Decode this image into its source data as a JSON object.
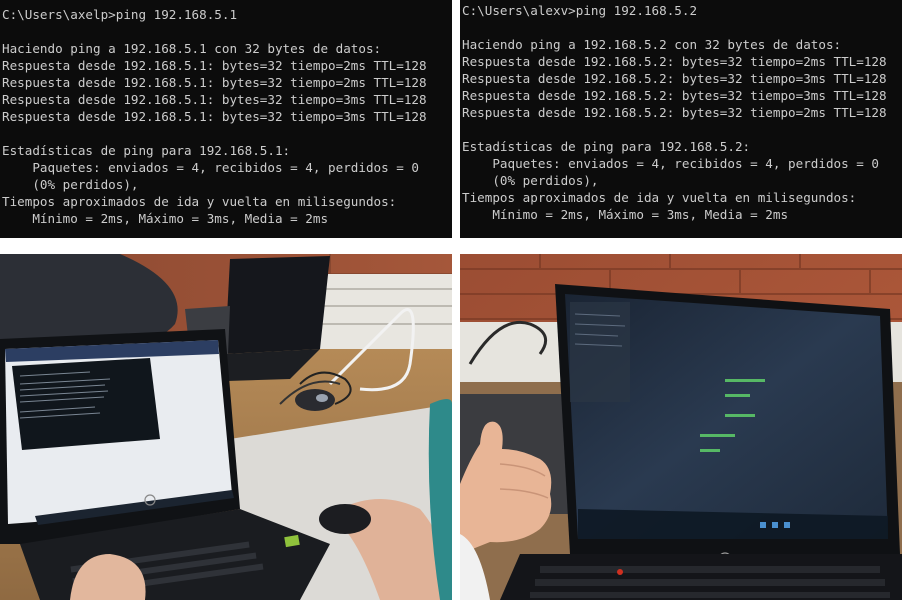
{
  "terminal_left": {
    "lines": [
      "C:\\Users\\axelp>ping 192.168.5.1",
      "",
      "Haciendo ping a 192.168.5.1 con 32 bytes de datos:",
      "Respuesta desde 192.168.5.1: bytes=32 tiempo=2ms TTL=128",
      "Respuesta desde 192.168.5.1: bytes=32 tiempo=2ms TTL=128",
      "Respuesta desde 192.168.5.1: bytes=32 tiempo=3ms TTL=128",
      "Respuesta desde 192.168.5.1: bytes=32 tiempo=3ms TTL=128",
      "",
      "Estadísticas de ping para 192.168.5.1:",
      "    Paquetes: enviados = 4, recibidos = 4, perdidos = 0",
      "    (0% perdidos),",
      "Tiempos aproximados de ida y vuelta en milisegundos:",
      "    Mínimo = 2ms, Máximo = 3ms, Media = 2ms"
    ]
  },
  "terminal_right": {
    "lines": [
      "C:\\Users\\alexv>ping 192.168.5.2",
      "",
      "Haciendo ping a 192.168.5.2 con 32 bytes de datos:",
      "Respuesta desde 192.168.5.2: bytes=32 tiempo=2ms TTL=128",
      "Respuesta desde 192.168.5.2: bytes=32 tiempo=3ms TTL=128",
      "Respuesta desde 192.168.5.2: bytes=32 tiempo=3ms TTL=128",
      "Respuesta desde 192.168.5.2: bytes=32 tiempo=2ms TTL=128",
      "",
      "Estadísticas de ping para 192.168.5.2:",
      "    Paquetes: enviados = 4, recibidos = 4, perdidos = 0",
      "    (0% perdidos),",
      "Tiempos aproximados de ida y vuelta en milisegundos:",
      "    Mínimo = 2ms, Máximo = 3ms, Media = 2ms"
    ]
  },
  "colors": {
    "terminal_bg": "#0c0c0c",
    "terminal_fg": "#cccccc"
  }
}
